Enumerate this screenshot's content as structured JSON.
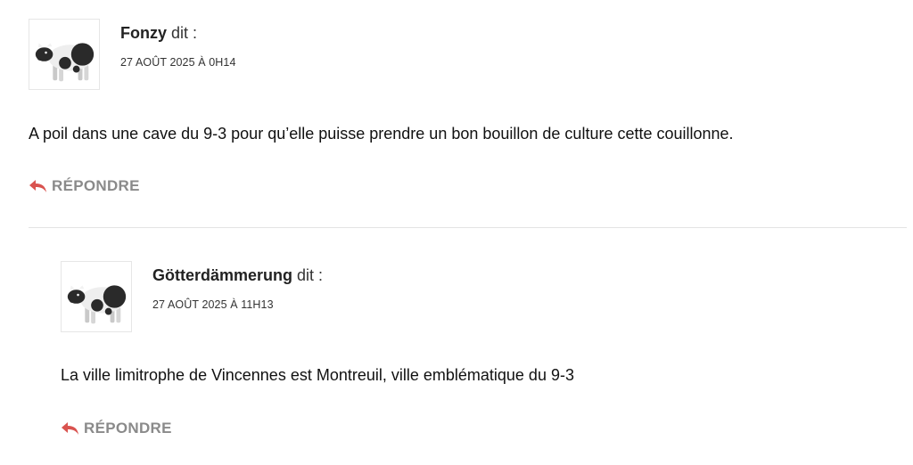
{
  "comments": [
    {
      "author": "Fonzy",
      "said": "dit :",
      "date": "27 AOÛT 2025 À 0H14",
      "text": "A poil dans une cave du 9-3 pour qu’elle puisse prendre un bon bouillon de culture cette couillonne.",
      "reply_label": "RÉPONDRE",
      "avatar_icon": "cow-icon"
    },
    {
      "author": "Götterdämmerung",
      "said": "dit :",
      "date": "27 AOÛT 2025 À 11H13",
      "text": "La ville limitrophe de Vincennes est Montreuil, ville emblématique du 9-3",
      "reply_label": "RÉPONDRE",
      "avatar_icon": "cow-icon"
    }
  ],
  "colors": {
    "reply_icon": "#d9534f",
    "reply_text": "#8a8a8a"
  }
}
